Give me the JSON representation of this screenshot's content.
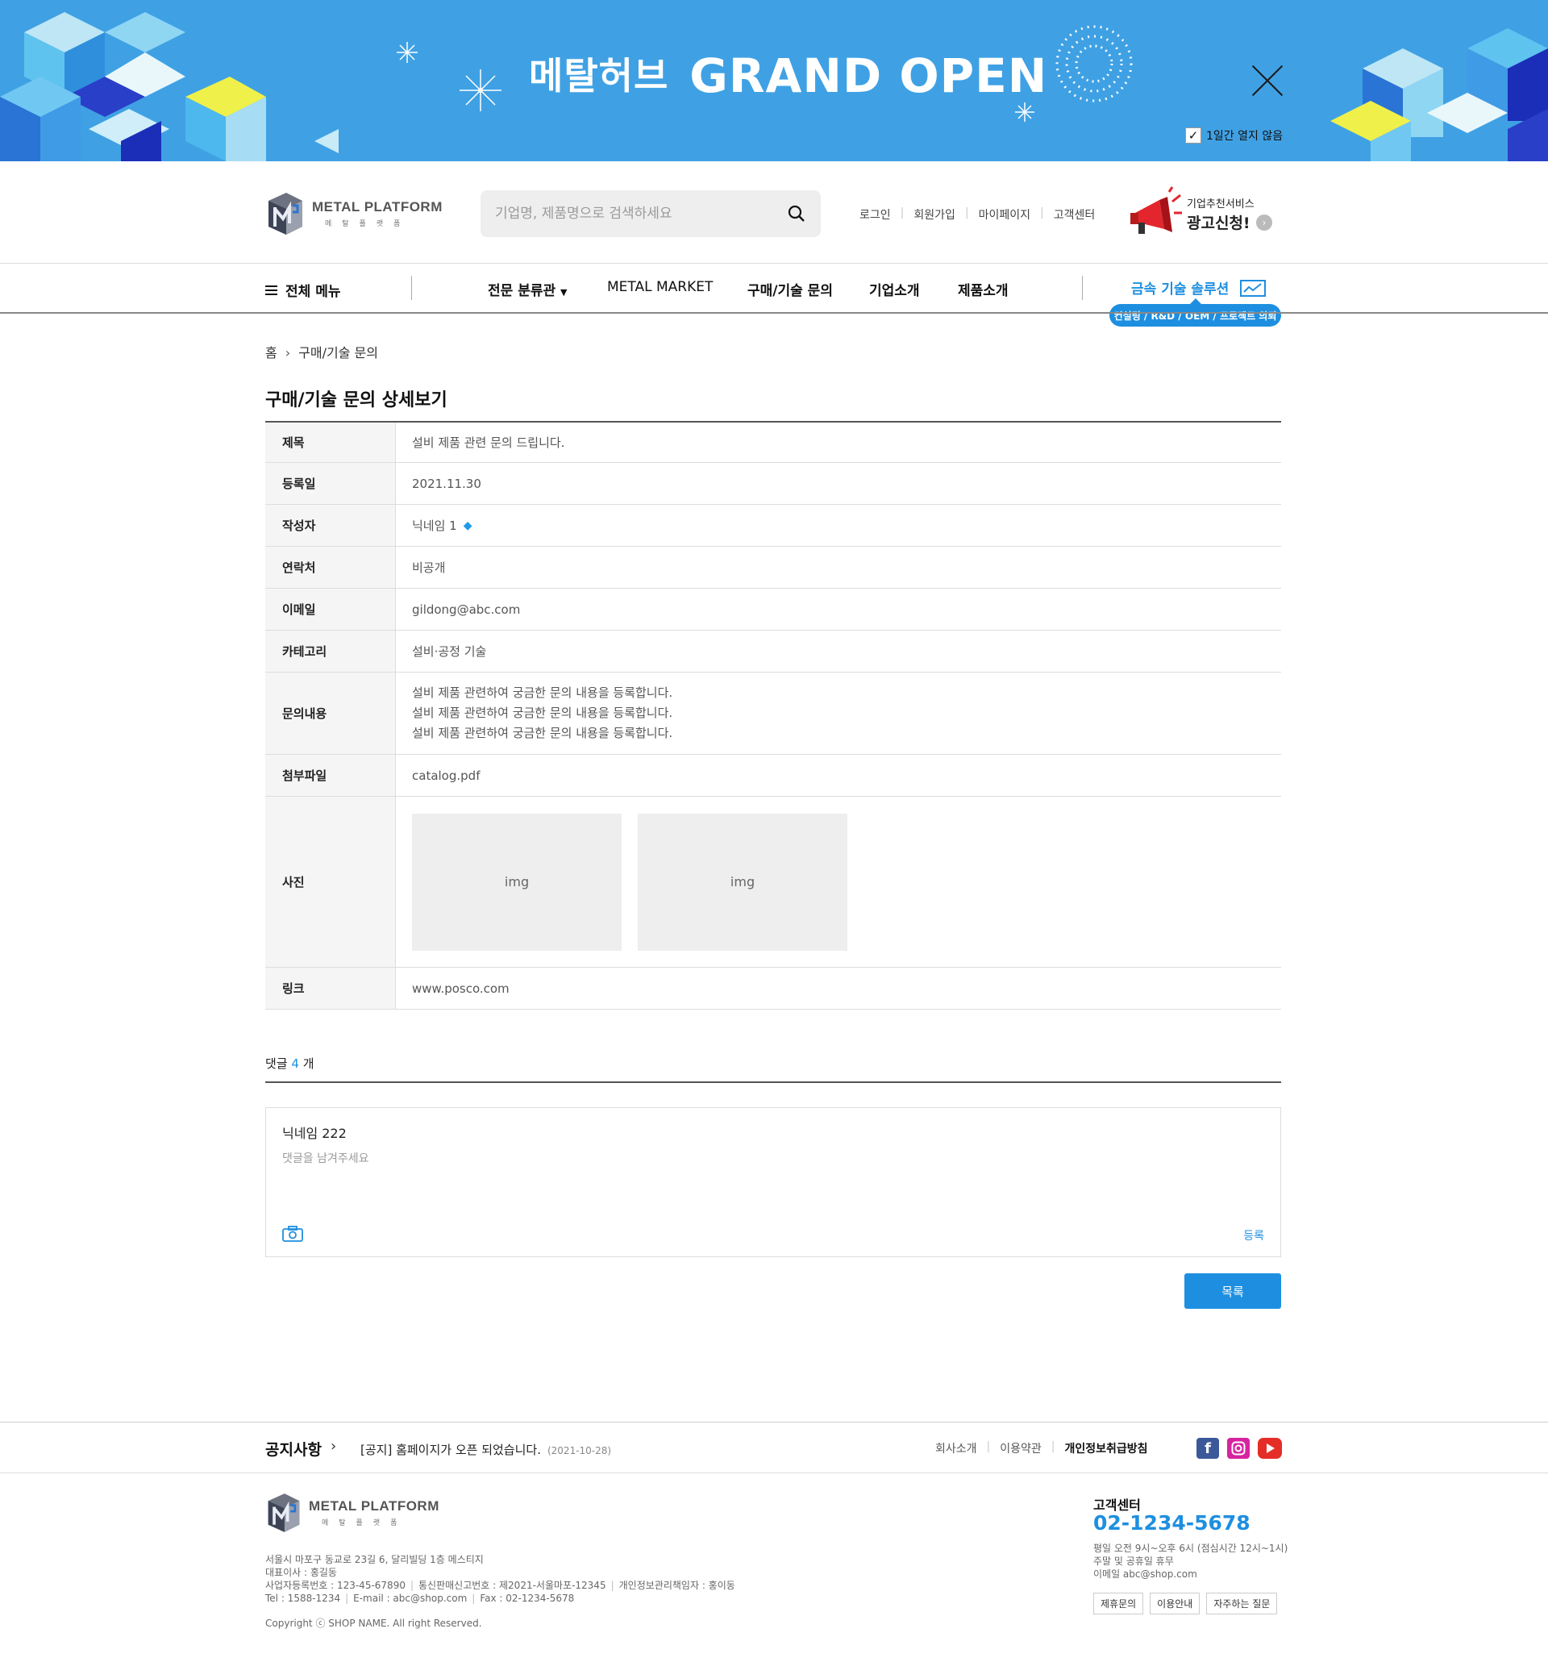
{
  "banner": {
    "title_kr": "메탈허브",
    "title_en": "GRAND OPEN",
    "dont_show_label": "1일간 열지 않음",
    "dont_show_checked": true
  },
  "header": {
    "logo": {
      "en": "METAL PLATFORM",
      "kr": "메탈플랫폼"
    },
    "search_placeholder": "기업명, 제품명으로 검색하세요",
    "util_links": [
      "로그인",
      "회원가입",
      "마이페이지",
      "고객센터"
    ],
    "ad": {
      "sub": "기업추천서비스",
      "main": "광고신청!"
    }
  },
  "nav": {
    "all_menu": "전체 메뉴",
    "items": [
      "전문 분류관",
      "METAL MARKET",
      "구매/기술 문의",
      "기업소개",
      "제품소개"
    ],
    "solution": "금속 기술 솔루션",
    "solution_badge": "컨설팅 / R&D / OEM / 프로젝트 의뢰"
  },
  "breadcrumb": {
    "home": "홈",
    "current": "구매/기술 문의"
  },
  "page_title": "구매/기술 문의 상세보기",
  "detail": {
    "subject": {
      "label": "제목",
      "value": "설비 제품 관련 문의 드립니다."
    },
    "date": {
      "label": "등록일",
      "value": "2021.11.30"
    },
    "author": {
      "label": "작성자",
      "value": "닉네임 1"
    },
    "contact": {
      "label": "연락처",
      "value": "비공개"
    },
    "email": {
      "label": "이메일",
      "value": "gildong@abc.com"
    },
    "category": {
      "label": "카테고리",
      "value": "설비·공정 기술"
    },
    "content": {
      "label": "문의내용",
      "lines": [
        "설비 제품 관련하여 궁금한 문의 내용을 등록합니다.",
        "설비 제품 관련하여 궁금한 문의 내용을 등록합니다.",
        "설비 제품 관련하여 궁금한 문의 내용을 등록합니다."
      ]
    },
    "attachment": {
      "label": "첨부파일",
      "value": "catalog.pdf"
    },
    "photos": {
      "label": "사진",
      "items": [
        "img",
        "img"
      ]
    },
    "link": {
      "label": "링크",
      "value": "www.posco.com"
    }
  },
  "comments": {
    "label_pre": "댓글",
    "count": "4",
    "label_post": "개",
    "nickname": "닉네임 222",
    "placeholder": "댓글을 남겨주세요",
    "submit": "등록"
  },
  "list_button": "목록",
  "footer": {
    "notice_title": "공지사항",
    "notice_text": "[공지] 홈페이지가 오픈 되었습니다.",
    "notice_date": "(2021-10-28)",
    "links": [
      "회사소개",
      "이용약관",
      "개인정보취급방침"
    ],
    "address": "서울시 마포구 동교로 23길 6, 달리빌딩 1층 메스티지",
    "ceo": "대표이사 : 홍길동",
    "biz_no": "사업자등록번호 : 123-45-67890",
    "mail_order": "통신판매신고번호 : 제2021-서울마포-12345",
    "privacy_officer": "개인정보관리책임자 : 홍이동",
    "tel": "Tel : 1588-1234",
    "email": "E-mail : abc@shop.com",
    "fax": "Fax : 02-1234-5678",
    "copyright": "Copyright ⓒ SHOP NAME. All right Reserved.",
    "cs": {
      "title": "고객센터",
      "phone": "02-1234-5678",
      "hours": "평일 오전 9시~오후 6시 (점심시간 12시~1시)",
      "closed": "주말 및 공휴일 휴무",
      "email": "이메일 abc@shop.com",
      "buttons": [
        "제휴문의",
        "이용안내",
        "자주하는 질문"
      ]
    }
  },
  "colors": {
    "accent": "#1e8fe0",
    "banner_bg": "#3fa1e4"
  }
}
